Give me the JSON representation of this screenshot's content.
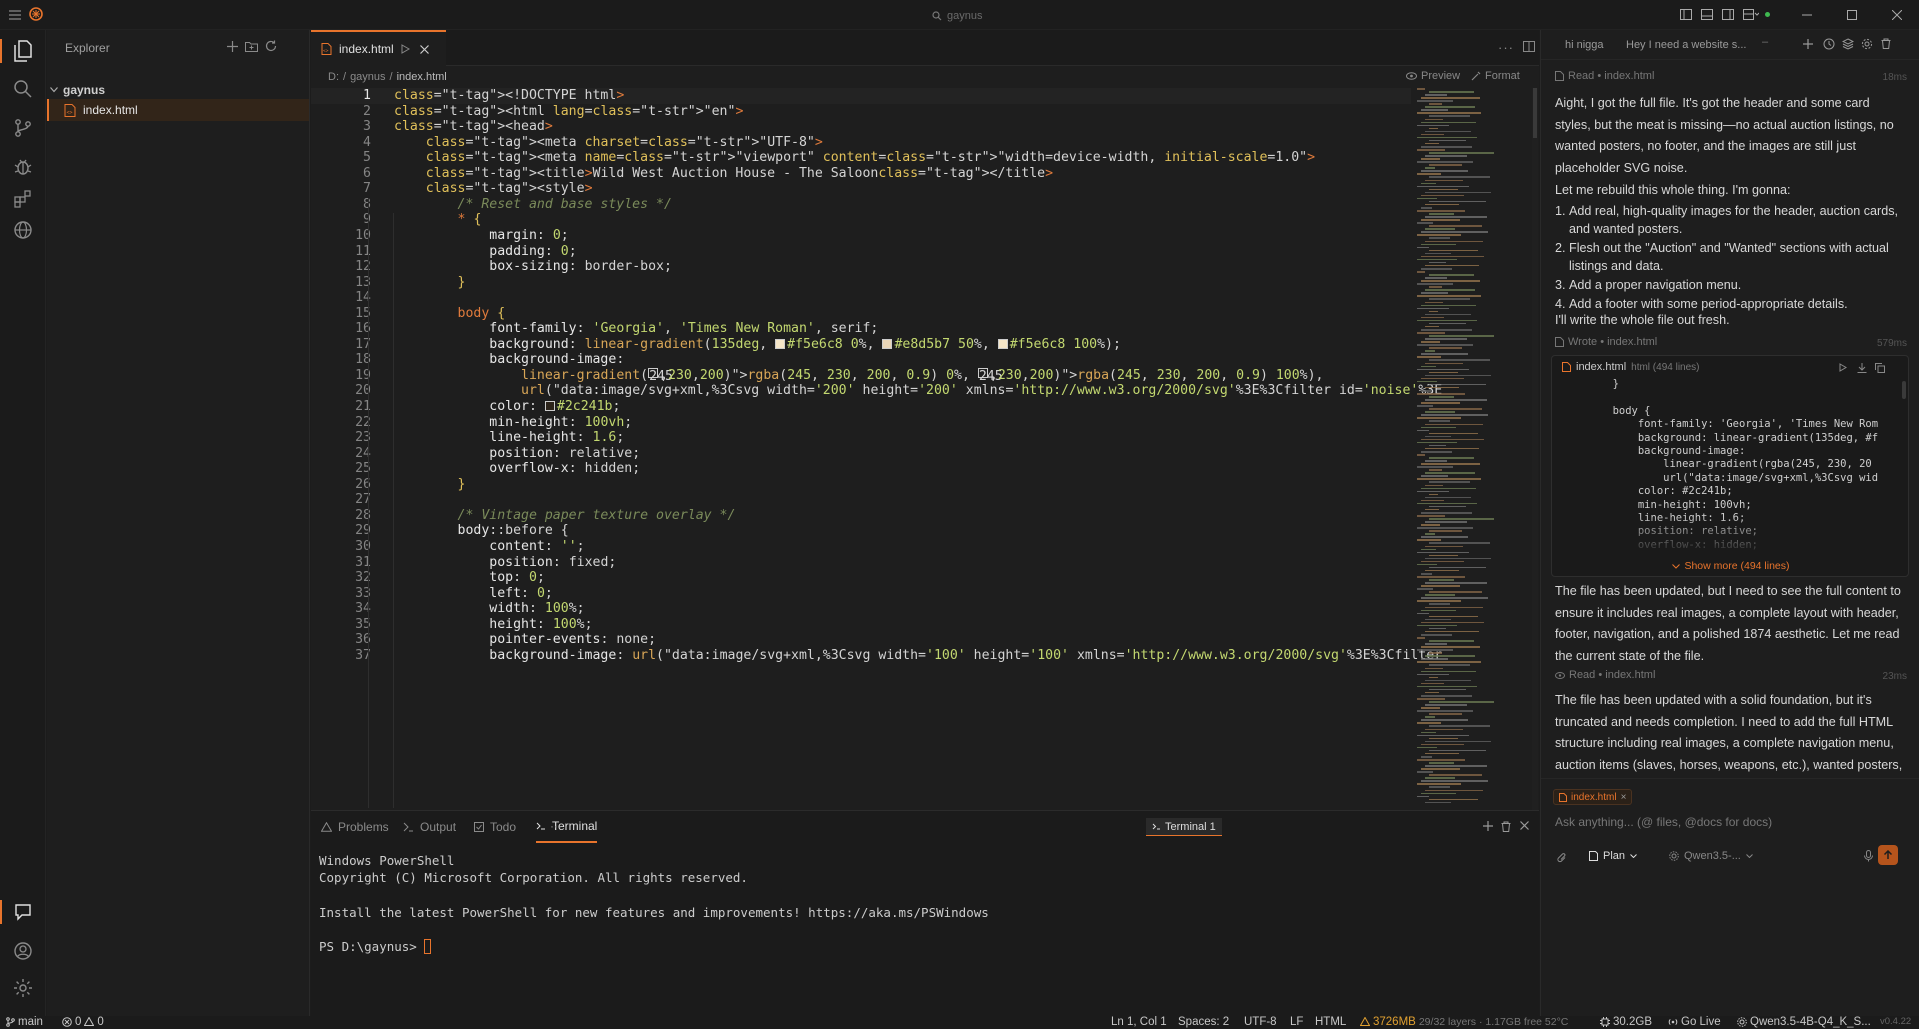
{
  "titlebar": {
    "search": "gaynus"
  },
  "explorer": {
    "title": "Explorer",
    "folder": "gaynus",
    "file": "index.html"
  },
  "editor": {
    "tab": "index.html",
    "breadcrumb": [
      "D:",
      "gaynus",
      "index.html"
    ],
    "preview_label": "Preview",
    "format_label": "Format",
    "lines": [
      "<!DOCTYPE html>",
      "<html lang=\"en\">",
      "<head>",
      "    <meta charset=\"UTF-8\">",
      "    <meta name=\"viewport\" content=\"width=device-width, initial-scale=1.0\">",
      "    <title>Wild West Auction House - The Saloon</title>",
      "    <style>",
      "        /* Reset and base styles */",
      "        * {",
      "            margin: 0;",
      "            padding: 0;",
      "            box-sizing: border-box;",
      "        }",
      "",
      "        body {",
      "            font-family: 'Georgia', 'Times New Roman', serif;",
      "            background: linear-gradient(135deg, #f5e6c8 0%, #e8d5b7 50%, #f5e6c8 100%);",
      "            background-image:",
      "                linear-gradient(rgba(245, 230, 200, 0.9) 0%, rgba(245, 230, 200, 0.9) 100%),",
      "                url(\"data:image/svg+xml,%3Csvg width='200' height='200' xmlns='http://www.w3.org/2000/svg'%3E%3Cfilter id='noise'%3E",
      "            color: #2c241b;",
      "            min-height: 100vh;",
      "            line-height: 1.6;",
      "            position: relative;",
      "            overflow-x: hidden;",
      "        }",
      "",
      "        /* Vintage paper texture overlay */",
      "        body::before {",
      "            content: '';",
      "            position: fixed;",
      "            top: 0;",
      "            left: 0;",
      "            width: 100%;",
      "            height: 100%;",
      "            pointer-events: none;",
      "            background-image: url(\"data:image/svg+xml,%3Csvg width='100' height='100' xmlns='http://www.w3.org/2000/svg'%3E%3Cfilter"
    ]
  },
  "panel": {
    "tabs": [
      "Problems",
      "Output",
      "Todo",
      "Terminal"
    ],
    "terminal_name": "Terminal 1",
    "terminal_lines": [
      "Windows PowerShell",
      "Copyright (C) Microsoft Corporation. All rights reserved.",
      "",
      "Install the latest PowerShell for new features and improvements! https://aka.ms/PSWindows",
      "",
      "PS D:\\gaynus> "
    ]
  },
  "chat": {
    "tabs": [
      "hi nigga",
      "Hey I need a website s..."
    ],
    "read_1": "Read • index.html",
    "read_1_time": "18ms",
    "msg_1": "Aight, I got the full file. It's got the header and some card styles, but the meat is missing—no actual auction listings, no wanted posters, no footer, and the images are still just placeholder SVG noise.",
    "msg_2": "Let me rebuild this whole thing. I'm gonna:",
    "list": [
      "Add real, high-quality images for the header, auction cards, and wanted posters.",
      "Flesh out the \"Auction\" and \"Wanted\" sections with actual listings and data.",
      "Add a proper navigation menu.",
      "Add a footer with some period-appropriate details."
    ],
    "msg_3": "I'll write the whole file out fresh.",
    "wrote": "Wrote • index.html",
    "wrote_time": "579ms",
    "file_card_name": "index.html",
    "file_card_meta": "html (494 lines)",
    "file_card_lines": [
      "        }",
      "",
      "        body {",
      "            font-family: 'Georgia', 'Times New Rom",
      "            background: linear-gradient(135deg, #f",
      "            background-image:",
      "                linear-gradient(rgba(245, 230, 20",
      "                url(\"data:image/svg+xml,%3Csvg wid",
      "            color: #2c241b;",
      "            min-height: 100vh;",
      "            line-height: 1.6;",
      "            position: relative;",
      "            overflow-x: hidden;"
    ],
    "show_more": "Show more (494 lines)",
    "msg_4": "The file has been updated, but I need to see the full content to ensure it includes real images, a complete layout with header, footer, navigation, and a polished 1874 aesthetic. Let me read the current state of the file.",
    "read_2": "Read • index.html",
    "read_2_time": "23ms",
    "msg_5": "The file has been updated with a solid foundation, but it's truncated and needs completion. I need to add the full HTML structure including real images, a complete navigation menu, auction items (slaves, horses, weapons, etc.), wanted posters, a footer, and polish everything to look",
    "attached_file": "index.html",
    "input_placeholder": "Ask anything... (@ files, @docs for docs)",
    "mode": "Plan",
    "model": "Qwen3.5-..."
  },
  "status": {
    "branch": "main",
    "errors": "0",
    "warnings": "0",
    "position": "Ln 1, Col 1",
    "spaces": "Spaces: 2",
    "encoding": "UTF-8",
    "eol": "LF",
    "language": "HTML",
    "memory": "3726MB",
    "layers": "29/32 layers · 1.17GB free 52°C",
    "ram": "30.2GB",
    "golive": "Go Live",
    "model": "Qwen3.5-4B-Q4_K_S...",
    "version": "v0.4.22"
  },
  "colors": {
    "accent": "#e8742c",
    "background": "#1e1e1e"
  }
}
